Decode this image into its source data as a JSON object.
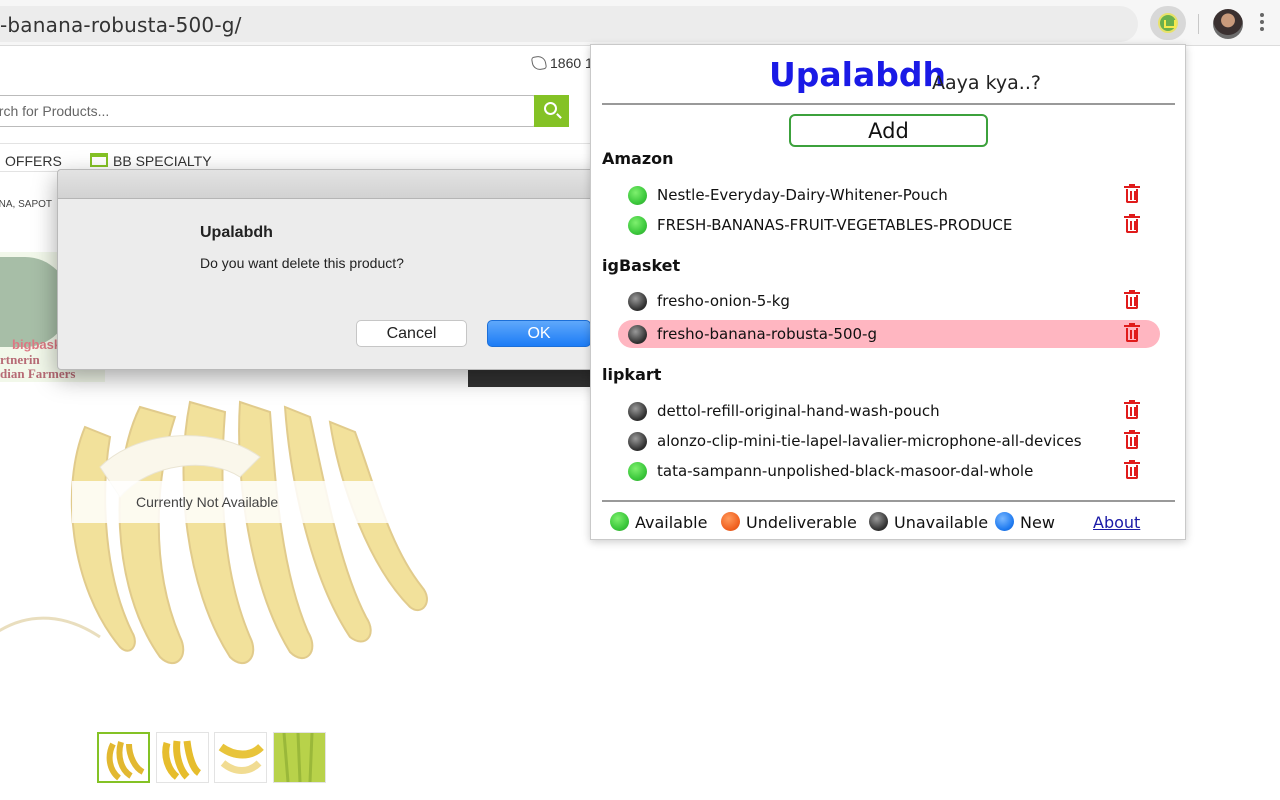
{
  "browser": {
    "url": "-banana-robusta-500-g/"
  },
  "site": {
    "phone": "1860 1",
    "search_placeholder": "arch for Products...",
    "nav_offers": "OFFERS",
    "nav_specialty": "BB SPECIALTY",
    "breadcrumb": "ANA, SAPOT",
    "logo_line1": "bigbask",
    "logo_line2": "rtnerin",
    "logo_line3": "dian Farmers",
    "availability": "Currently Not Available"
  },
  "dialog": {
    "title": "Upalabdh",
    "message": "Do you want delete this product?",
    "cancel_label": "Cancel",
    "ok_label": "OK"
  },
  "popup": {
    "brand": "Upalabdh",
    "tagline": "Aaya kya..?",
    "add_label": "Add",
    "sections": {
      "amazon": {
        "label": "Amazon",
        "items": [
          {
            "name": "Nestle-Everyday-Dairy-Whitener-Pouch",
            "status": "available"
          },
          {
            "name": "FRESH-BANANAS-FRUIT-VEGETABLES-PRODUCE",
            "status": "available"
          }
        ]
      },
      "bigbasket": {
        "label": "igBasket",
        "items": [
          {
            "name": "fresho-onion-5-kg",
            "status": "unavailable"
          },
          {
            "name": "fresho-banana-robusta-500-g",
            "status": "unavailable",
            "highlighted": true
          }
        ]
      },
      "flipkart": {
        "label": "lipkart",
        "items": [
          {
            "name": "dettol-refill-original-hand-wash-pouch",
            "status": "unavailable"
          },
          {
            "name": "alonzo-clip-mini-tie-lapel-lavalier-microphone-all-devices",
            "status": "unavailable"
          },
          {
            "name": "tata-sampann-unpolished-black-masoor-dal-whole",
            "status": "available"
          }
        ]
      }
    },
    "legend": {
      "available": "Available",
      "undeliverable": "Undeliverable",
      "unavailable": "Unavailable",
      "new": "New"
    },
    "about_label": "About"
  },
  "colors": {
    "brand": "#1a1ae6",
    "add_border": "#3ca13c",
    "highlight": "#ffb6c1",
    "delete": "#e01b1b",
    "site_accent": "#84c225"
  }
}
